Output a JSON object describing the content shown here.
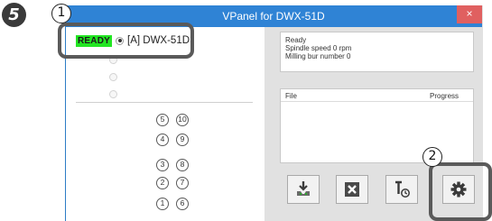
{
  "step": {
    "number": "5"
  },
  "window": {
    "title": "VPanel for DWX-51D",
    "close_label": "×"
  },
  "devices": {
    "selected": {
      "status_badge": "READY",
      "name": "[A] DWX-51D"
    }
  },
  "status": {
    "lines": [
      "Ready",
      "Spindle speed 0 rpm",
      "Milling bur number 0"
    ]
  },
  "file_list": {
    "columns": [
      "File",
      "Progress"
    ]
  },
  "bur_slots": {
    "right_column": [
      "10",
      "9",
      "8",
      "7",
      "6"
    ],
    "left_column": [
      "5",
      "4",
      "3",
      "2",
      "1"
    ]
  },
  "toolbar": {
    "buttons": [
      {
        "icon": "output-icon"
      },
      {
        "icon": "cancel-icon"
      },
      {
        "icon": "pause-timer-icon"
      },
      {
        "icon": "gear-icon"
      }
    ]
  },
  "callouts": {
    "first": "1",
    "second": "2"
  },
  "colors": {
    "titlebar": "#2f83d5",
    "ready": "#22e622",
    "close": "#e06060"
  }
}
